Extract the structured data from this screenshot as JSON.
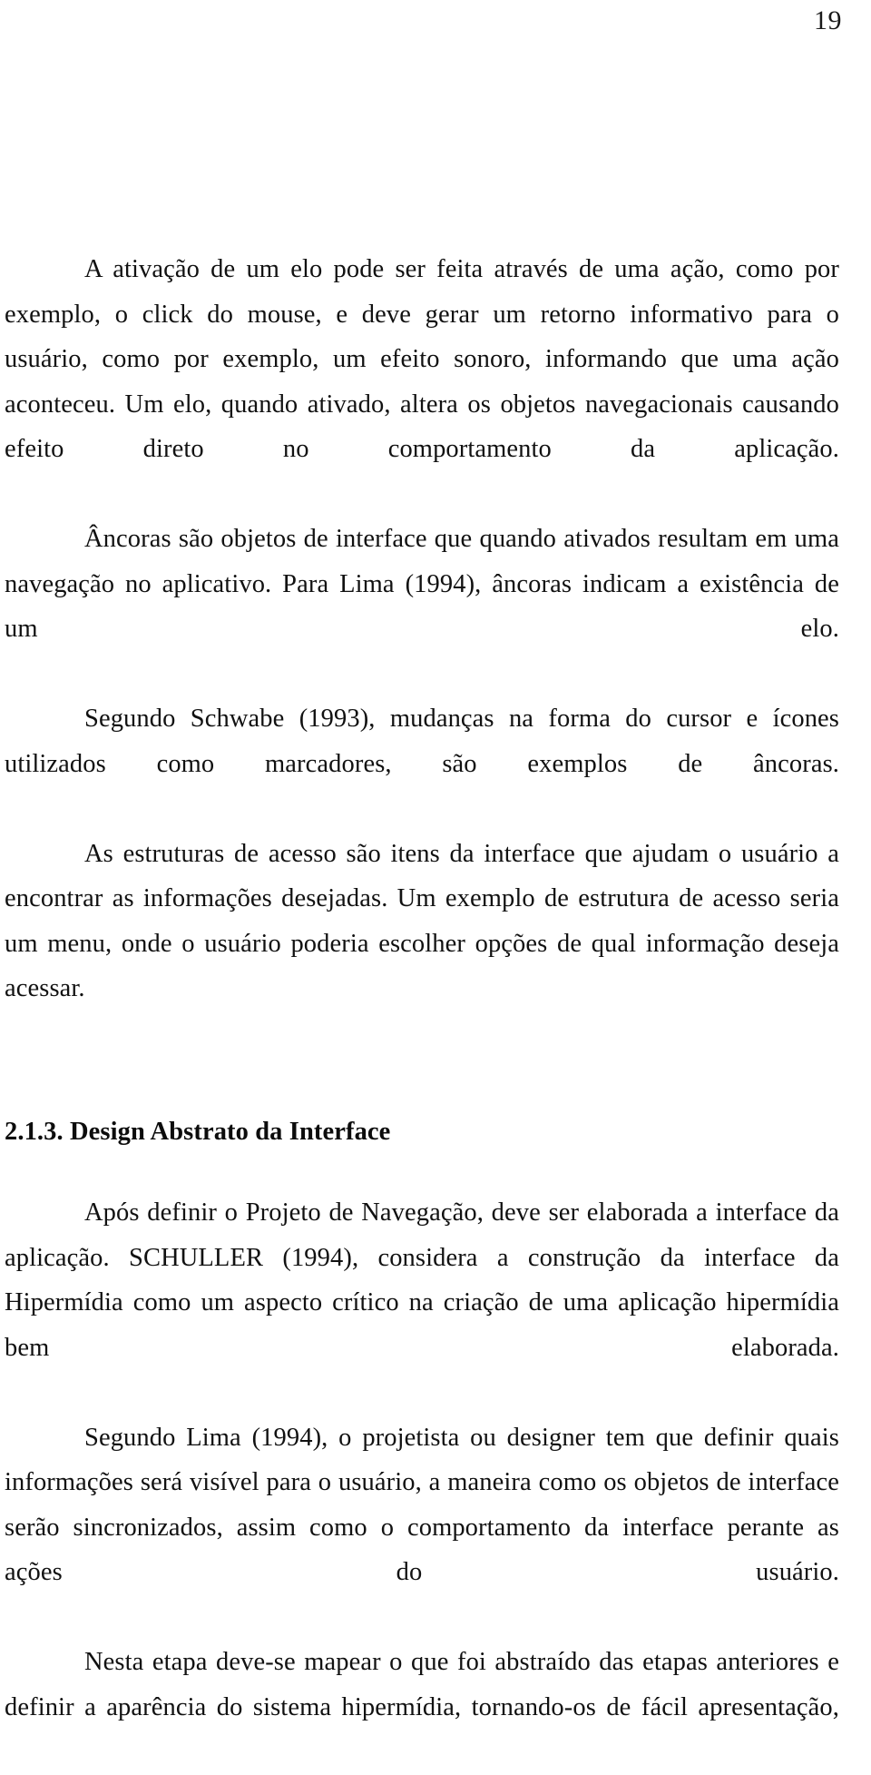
{
  "document": {
    "page_number": "19",
    "language": "pt-BR",
    "blocks": [
      {
        "type": "paragraph",
        "name": "paragraph-ativacao-elo",
        "text": "A ativação de um elo pode ser feita através de uma ação, como por exemplo, o click do mouse, e deve gerar um retorno informativo para o usuário, como por exemplo, um efeito sonoro, informando que uma ação aconteceu. Um elo, quando ativado, altera os objetos navegacionais causando efeito direto no comportamento da aplicação."
      },
      {
        "type": "paragraph",
        "name": "paragraph-ancoras",
        "text": "Âncoras são objetos de interface que quando ativados resultam em uma navegação no aplicativo. Para Lima (1994), âncoras indicam a existência de um elo."
      },
      {
        "type": "paragraph",
        "name": "paragraph-schwabe",
        "text": "Segundo Schwabe (1993), mudanças na forma do cursor e ícones utilizados como marcadores, são exemplos de âncoras."
      },
      {
        "type": "paragraph",
        "name": "paragraph-estruturas-acesso",
        "text": "As estruturas de acesso são itens da interface que ajudam o usuário a encontrar as informações desejadas. Um exemplo de estrutura de acesso seria um menu, onde o usuário poderia escolher opções de qual informação deseja acessar."
      },
      {
        "type": "heading",
        "name": "heading-design-abstrato",
        "text": "2.1.3. Design Abstrato da Interface"
      },
      {
        "type": "paragraph",
        "name": "paragraph-schuller",
        "text": "Após definir o Projeto de Navegação, deve ser elaborada a interface da aplicação. SCHULLER (1994), considera a construção da interface da Hipermídia como um aspecto crítico na criação de uma aplicação hipermídia bem elaborada."
      },
      {
        "type": "paragraph",
        "name": "paragraph-lima",
        "text": "Segundo Lima (1994), o projetista ou designer tem que definir quais informações será visível para o usuário, a maneira como os objetos de interface serão sincronizados, assim como o comportamento da interface perante as ações do usuário."
      },
      {
        "type": "paragraph",
        "name": "paragraph-nesta-etapa",
        "text": "Nesta etapa deve-se mapear o que foi abstraído das etapas anteriores e definir a aparência do sistema hipermídia, tornando-os de fácil apresentação,"
      }
    ]
  }
}
